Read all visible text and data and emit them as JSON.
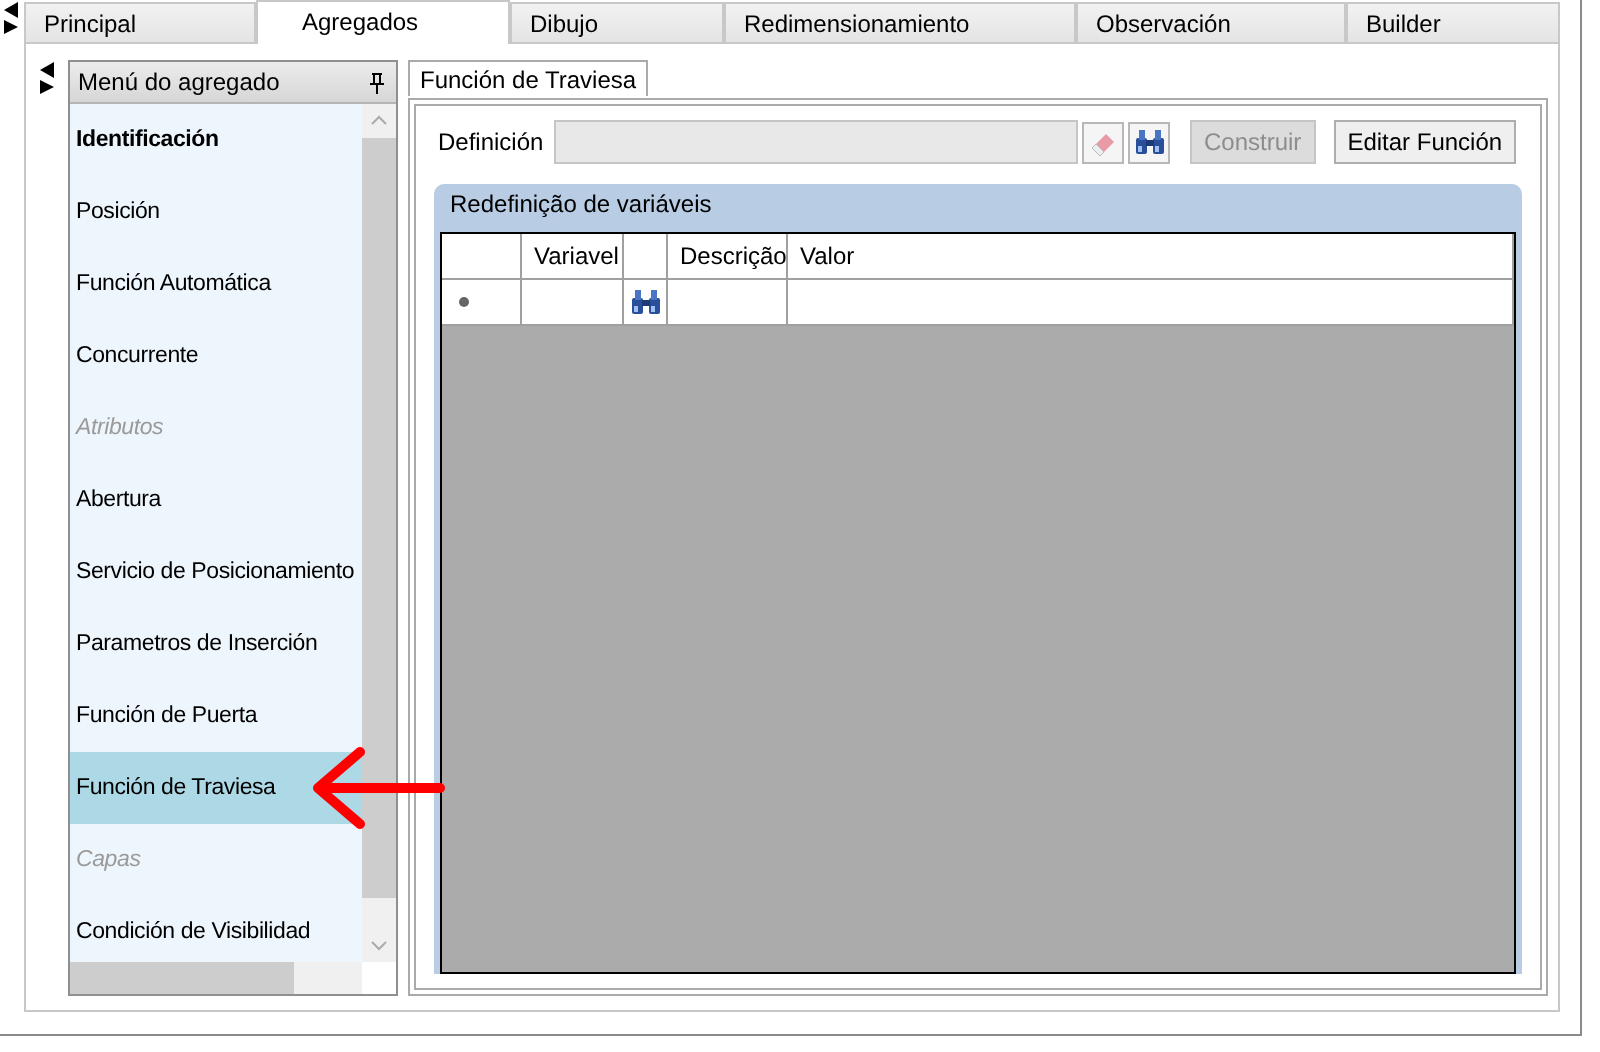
{
  "tabs": [
    {
      "label": "Principal",
      "selected": false
    },
    {
      "label": "Agregados",
      "selected": true
    },
    {
      "label": "Dibujo",
      "selected": false
    },
    {
      "label": "Redimensionamiento",
      "selected": false
    },
    {
      "label": "Observación",
      "selected": false
    },
    {
      "label": "Builder",
      "selected": false
    }
  ],
  "menu": {
    "title": "Menú do agregado",
    "items": [
      {
        "label": "Identificación",
        "kind": "title",
        "selected": false
      },
      {
        "label": "Posición",
        "kind": "item",
        "selected": false
      },
      {
        "label": "Función Automática",
        "kind": "item",
        "selected": false
      },
      {
        "label": "Concurrente",
        "kind": "item",
        "selected": false
      },
      {
        "label": "Atributos",
        "kind": "category",
        "selected": false
      },
      {
        "label": "Abertura",
        "kind": "item",
        "selected": false
      },
      {
        "label": "Servicio de Posicionamiento",
        "kind": "item",
        "selected": false
      },
      {
        "label": "Parametros de Inserción",
        "kind": "item",
        "selected": false
      },
      {
        "label": "Función de Puerta",
        "kind": "item",
        "selected": false
      },
      {
        "label": "Función de Traviesa",
        "kind": "item",
        "selected": true
      },
      {
        "label": "Capas",
        "kind": "category",
        "selected": false
      },
      {
        "label": "Condición de Visibilidad",
        "kind": "item",
        "selected": false
      }
    ]
  },
  "panel": {
    "tab": "Función de Traviesa",
    "definition_label": "Definición",
    "buttons": [
      {
        "label": "Construir",
        "disabled": true
      },
      {
        "label": "Editar Función",
        "disabled": false
      }
    ],
    "group_title": "Redefinição de variáveis",
    "table": {
      "columns": [
        "Variavel",
        "",
        "Descrição",
        "Valor"
      ]
    }
  }
}
